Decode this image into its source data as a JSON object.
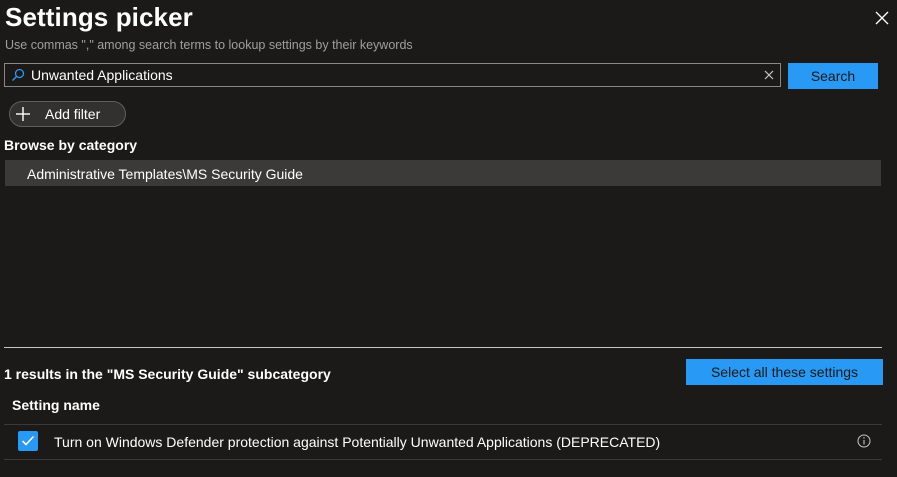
{
  "panel": {
    "title": "Settings picker",
    "subtitle": "Use commas \",\" among search terms to lookup settings by their keywords"
  },
  "search": {
    "value": "Unwanted Applications",
    "button_label": "Search"
  },
  "filter": {
    "add_filter_label": "Add filter"
  },
  "browse": {
    "heading": "Browse by category",
    "categories": [
      {
        "label": "Administrative Templates\\MS Security Guide",
        "selected": true
      }
    ]
  },
  "results": {
    "summary": "1 results in the \"MS Security Guide\" subcategory",
    "select_all_label": "Select all these settings",
    "column_header": "Setting name",
    "rows": [
      {
        "label": "Turn on Windows Defender protection against Potentially Unwanted Applications (DEPRECATED)",
        "checked": true
      }
    ]
  },
  "colors": {
    "background": "#1b1a19",
    "accent": "#2899f5",
    "selected_row": "#3b3a39",
    "muted_text": "#a19f9d"
  },
  "icons": {
    "close": "close-icon",
    "search": "search-icon",
    "clear": "clear-icon",
    "add": "plus-icon",
    "check": "checkmark-icon",
    "info": "info-icon"
  }
}
